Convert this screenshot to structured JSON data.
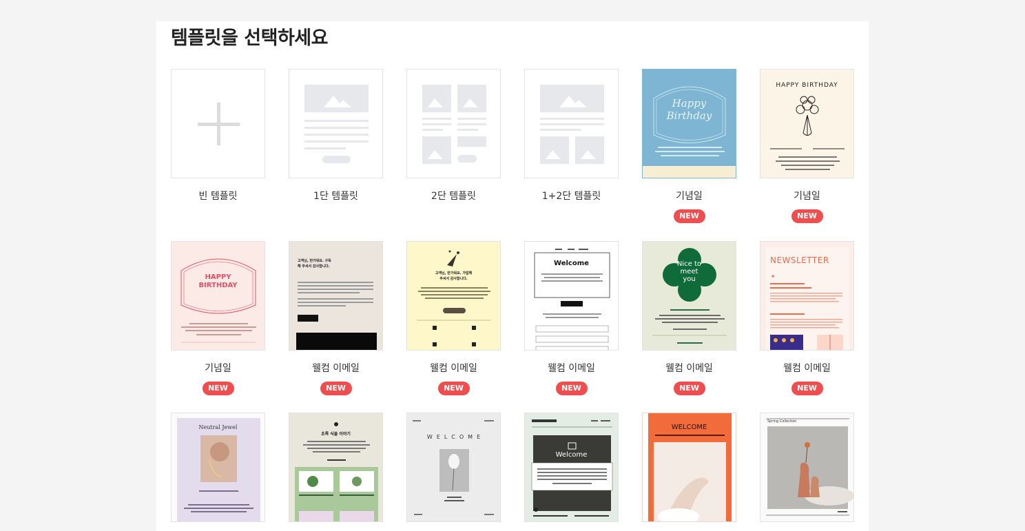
{
  "page": {
    "title": "템플릿을 선택하세요"
  },
  "templates": [
    {
      "label": "빈 템플릿",
      "badge": ""
    },
    {
      "label": "1단 템플릿",
      "badge": ""
    },
    {
      "label": "2단 템플릿",
      "badge": ""
    },
    {
      "label": "1+2단 템플릿",
      "badge": ""
    },
    {
      "label": "기념일",
      "badge": "NEW",
      "thumb_text": "Happy Birthday"
    },
    {
      "label": "기념일",
      "badge": "NEW",
      "thumb_text": "HAPPY BIRTHDAY"
    },
    {
      "label": "기념일",
      "badge": "NEW",
      "thumb_text": "HAPPY BIRTHDAY"
    },
    {
      "label": "웰컴 이메일",
      "badge": "NEW",
      "thumb_text": "고객님, 반가워요. 구독해 주셔서 감사합니다."
    },
    {
      "label": "웰컴 이메일",
      "badge": "NEW",
      "thumb_text": "고객님, 반가워요. 가입해 주셔서 감사합니다."
    },
    {
      "label": "웰컴 이메일",
      "badge": "NEW",
      "thumb_text": "Welcome"
    },
    {
      "label": "웰컴 이메일",
      "badge": "NEW",
      "thumb_text": "Nice to meet you"
    },
    {
      "label": "웰컴 이메일",
      "badge": "NEW",
      "thumb_text": "NEWSLETTER"
    },
    {
      "label": "",
      "badge": "",
      "thumb_text": "Neutral Jewel"
    },
    {
      "label": "",
      "badge": "",
      "thumb_text": "초록 식물 이야기"
    },
    {
      "label": "",
      "badge": "",
      "thumb_text": "WELCOME"
    },
    {
      "label": "",
      "badge": "",
      "thumb_text": "Welcome"
    },
    {
      "label": "",
      "badge": "",
      "thumb_text": "WELCOME"
    },
    {
      "label": "",
      "badge": "",
      "thumb_text": "Spring Collection"
    }
  ],
  "colors": {
    "badge": "#f04e4e",
    "placeholder": "#e6e8ec",
    "birthday_blue": "#7db5d2",
    "cream": "#fdf4e8",
    "pink": "#fbeae6",
    "yellow": "#fef7c9",
    "green": "#e7ead9",
    "orange": "#f26b3a"
  }
}
